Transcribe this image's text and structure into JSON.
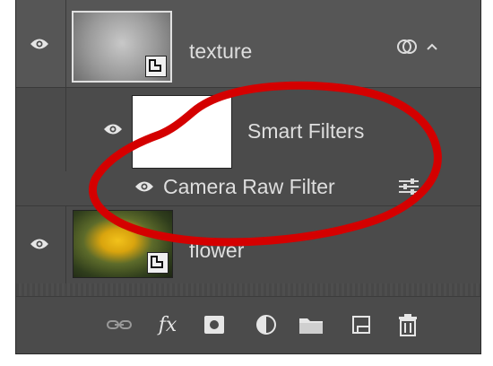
{
  "layers": [
    {
      "name": "texture",
      "badge_icon": "linked-circles-icon",
      "expand_icon": "chevron-up-icon"
    },
    {
      "name": "Smart Filters"
    },
    {
      "name": "Camera Raw Filter",
      "options_icon": "filter-options-icon"
    },
    {
      "name": "flower"
    }
  ],
  "footer_icons": [
    "link-layers-icon",
    "fx-icon",
    "add-mask-icon",
    "adjustment-layer-icon",
    "folder-icon",
    "new-layer-icon",
    "trash-icon"
  ],
  "footer_fx_label": "fx",
  "colors": {
    "panel": "#4b4b4b",
    "highlight": "#d40000",
    "text": "#dedede"
  }
}
